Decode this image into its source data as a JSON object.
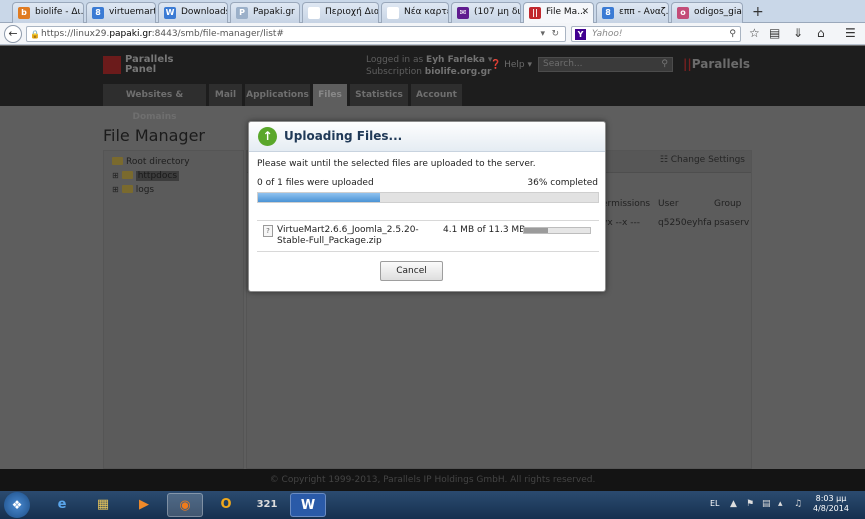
{
  "browser": {
    "tabs": [
      {
        "label": "biolife - Δι...",
        "icon_color": "#e07b21",
        "glyph": "b"
      },
      {
        "label": "virtuemart ...",
        "icon_color": "#3b7bd4",
        "glyph": "8"
      },
      {
        "label": "Downloads",
        "icon_color": "#3b7bd4",
        "glyph": "W"
      },
      {
        "label": "Papaki.gr",
        "icon_color": "#9bb0c9",
        "glyph": "P"
      },
      {
        "label": "Περιοχή Διαχεί...",
        "icon_color": "#ffffff",
        "glyph": ""
      },
      {
        "label": "Νέα καρτέλα",
        "icon_color": "#ffffff",
        "glyph": ""
      },
      {
        "label": "(107 μη δια...",
        "icon_color": "#5f1b8f",
        "glyph": "✉"
      },
      {
        "label": "File Ma...",
        "icon_color": "#c1272d",
        "glyph": "||"
      },
      {
        "label": "εππ - Αναζ...",
        "icon_color": "#3b7bd4",
        "glyph": "8"
      },
      {
        "label": "odigos_gia...",
        "icon_color": "#c34c78",
        "glyph": "o"
      }
    ],
    "new_tab": "+",
    "url_prefix": "https://linux29.",
    "url_host": "papaki.gr",
    "url_rest": ":8443/smb/file-manager/list#",
    "search_placeholder": "Yahoo!",
    "search_logo": "Y"
  },
  "panel": {
    "brand_line1": "Parallels",
    "brand_line2": "Panel",
    "logged_label": "Logged in as",
    "user_name": "Eyh Farleka",
    "subscription_label": "Subscription",
    "subscription_value": "biolife.org.gr",
    "help": "Help",
    "search_placeholder": "Search...",
    "logo": "Parallels",
    "tabs": [
      "Websites & Domains",
      "Mail",
      "Applications",
      "Files",
      "Statistics",
      "Account"
    ],
    "active_tab": "Files",
    "page_title": "File Manager",
    "tree": {
      "root": "Root directory",
      "folders": [
        "httpdocs",
        "logs"
      ]
    },
    "change_settings": "Change Settings",
    "columns": {
      "permissions": "ermissions",
      "user": "User",
      "group": "Group"
    },
    "row": {
      "permissions": "vx --x ---",
      "user": "q5250eyhfa",
      "group": "psaserv"
    },
    "footer": "© Copyright 1999-2013, Parallels IP Holdings GmbH. All rights reserved."
  },
  "dialog": {
    "title": "Uploading Files...",
    "message": "Please wait until the selected files are uploaded to the server.",
    "count_text": "0 of 1 files were uploaded",
    "percent_text": "36% completed",
    "overall_progress": 0.36,
    "file": {
      "name": "VirtueMart2.6.6_Joomla_2.5.20-Stable-Full_Package.zip",
      "size": "4.1 MB of 11.3 MB",
      "progress": 0.36
    },
    "cancel_label": "Cancel"
  },
  "taskbar": {
    "apps": [
      "ie",
      "explorer",
      "media",
      "firefox",
      "outlook",
      "calendar",
      "word"
    ],
    "language": "EL",
    "time": "8:03 μμ",
    "date": "4/8/2014"
  }
}
